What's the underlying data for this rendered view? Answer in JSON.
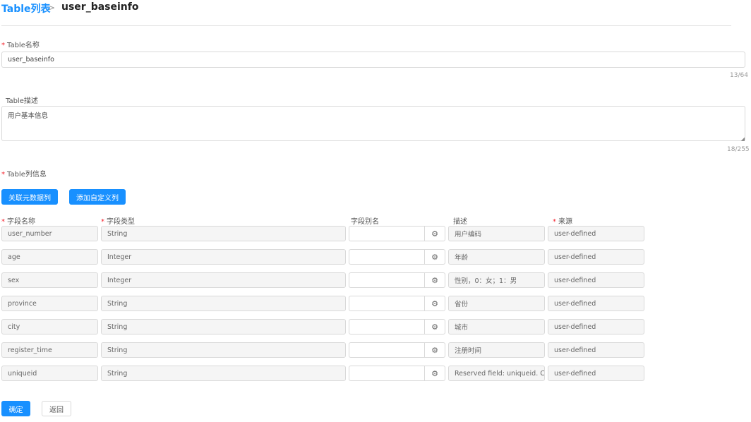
{
  "breadcrumb": {
    "parent": "Table列表",
    "separator": ">",
    "current": "user_baseinfo"
  },
  "form": {
    "name": {
      "label": "Table名称",
      "value": "user_baseinfo",
      "counter": "13/64"
    },
    "desc": {
      "label": "Table描述",
      "value": "用户基本信息",
      "counter": "18/255"
    },
    "columns_label": "Table列信息"
  },
  "buttons": {
    "link_meta": "关联元数据列",
    "add_custom": "添加自定义列",
    "confirm": "确定",
    "back": "返回"
  },
  "table": {
    "headers": {
      "name": "字段名称",
      "type": "字段类型",
      "alias": "字段别名",
      "desc": "描述",
      "source": "来源"
    },
    "rows": [
      {
        "name": "user_number",
        "type": "String",
        "alias": "",
        "desc": "用户编码",
        "source": "user-defined"
      },
      {
        "name": "age",
        "type": "Integer",
        "alias": "",
        "desc": "年龄",
        "source": "user-defined"
      },
      {
        "name": "sex",
        "type": "Integer",
        "alias": "",
        "desc": "性别，0：女；1：男",
        "source": "user-defined"
      },
      {
        "name": "province",
        "type": "String",
        "alias": "",
        "desc": "省份",
        "source": "user-defined"
      },
      {
        "name": "city",
        "type": "String",
        "alias": "",
        "desc": "城市",
        "source": "user-defined"
      },
      {
        "name": "register_time",
        "type": "String",
        "alias": "",
        "desc": "注册时间",
        "source": "user-defined"
      },
      {
        "name": "uniqueid",
        "type": "String",
        "alias": "",
        "desc": "Reserved field: uniqueid. Cre",
        "source": "user-defined"
      }
    ]
  }
}
